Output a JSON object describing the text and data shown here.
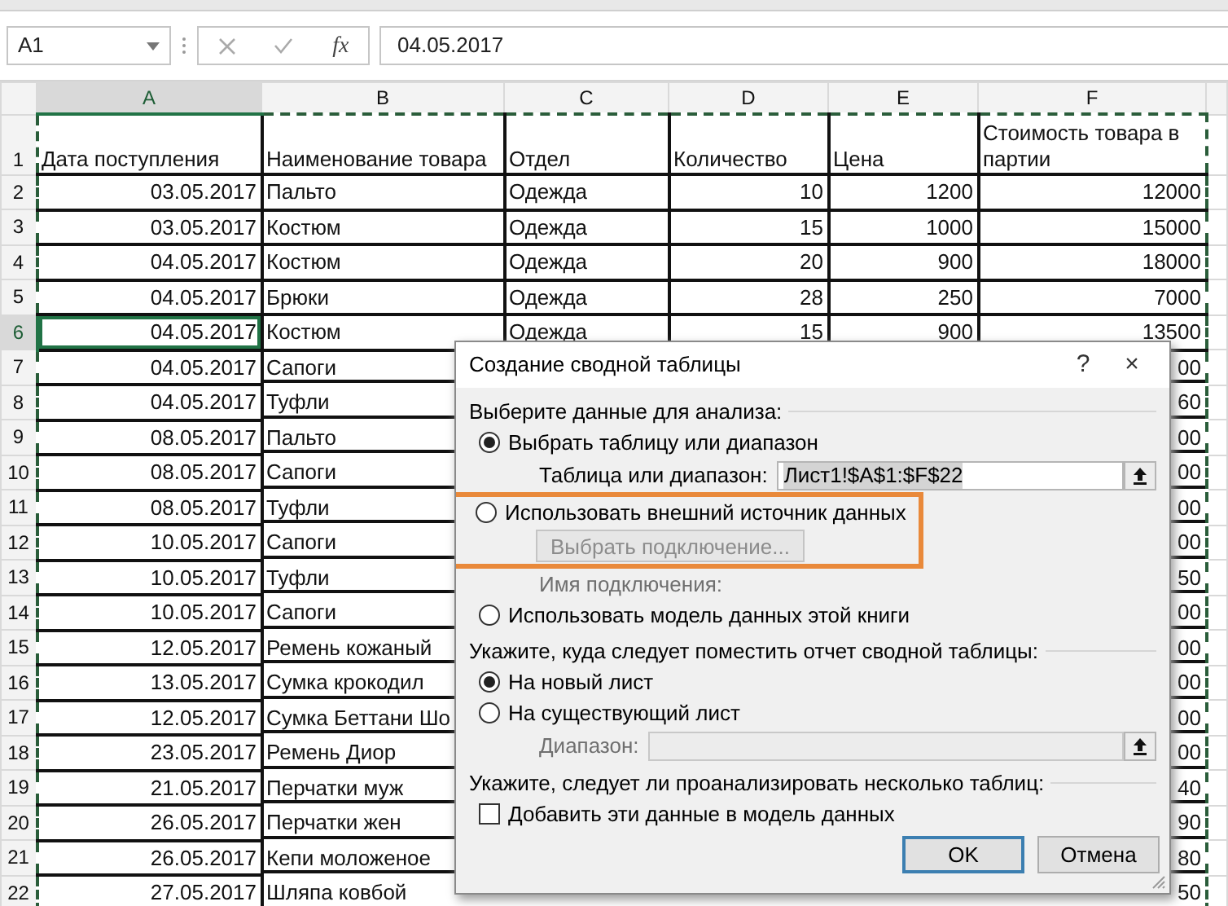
{
  "name_box": {
    "value": "A1"
  },
  "formula_bar": {
    "function_label": "fx",
    "value": "04.05.2017"
  },
  "sheet": {
    "columns": [
      {
        "letter": "A",
        "selected": true,
        "kind": "date"
      },
      {
        "letter": "B",
        "selected": false,
        "kind": "text"
      },
      {
        "letter": "C",
        "selected": false,
        "kind": "text"
      },
      {
        "letter": "D",
        "selected": false,
        "kind": "number"
      },
      {
        "letter": "E",
        "selected": false,
        "kind": "number"
      },
      {
        "letter": "F",
        "selected": false,
        "kind": "number"
      }
    ],
    "rows": [
      {
        "number": "1",
        "kind": "header",
        "selected": false,
        "cells": {
          "A": "Дата поступления",
          "B": "Наименование товара",
          "C": "Отдел",
          "D": "Количество",
          "E": "Цена",
          "F": "Стоимость товара в партии"
        }
      },
      {
        "number": "2",
        "kind": "data",
        "selected": false,
        "cells": {
          "A": "03.05.2017",
          "B": "Пальто",
          "C": "Одежда",
          "D": "10",
          "E": "1200",
          "F": "12000"
        }
      },
      {
        "number": "3",
        "kind": "data",
        "selected": false,
        "cells": {
          "A": "03.05.2017",
          "B": "Костюм",
          "C": "Одежда",
          "D": "15",
          "E": "1000",
          "F": "15000"
        }
      },
      {
        "number": "4",
        "kind": "data",
        "selected": false,
        "cells": {
          "A": "04.05.2017",
          "B": "Костюм",
          "C": "Одежда",
          "D": "20",
          "E": "900",
          "F": "18000"
        }
      },
      {
        "number": "5",
        "kind": "data",
        "selected": false,
        "cells": {
          "A": "04.05.2017",
          "B": "Брюки",
          "C": "Одежда",
          "D": "28",
          "E": "250",
          "F": "7000"
        }
      },
      {
        "number": "6",
        "kind": "data",
        "selected": true,
        "cells": {
          "A": "04.05.2017",
          "B": "Костюм",
          "C": "Одежда",
          "D": "15",
          "E": "900",
          "F": "13500"
        }
      },
      {
        "number": "7",
        "kind": "data",
        "selected": false,
        "cells": {
          "A": "04.05.2017",
          "B": "Сапоги",
          "F": "00"
        }
      },
      {
        "number": "8",
        "kind": "data",
        "selected": false,
        "cells": {
          "A": "04.05.2017",
          "B": "Туфли",
          "F": "60"
        }
      },
      {
        "number": "9",
        "kind": "data",
        "selected": false,
        "cells": {
          "A": "08.05.2017",
          "B": "Пальто",
          "F": "00"
        }
      },
      {
        "number": "10",
        "kind": "data",
        "selected": false,
        "cells": {
          "A": "08.05.2017",
          "B": "Сапоги",
          "F": "00"
        }
      },
      {
        "number": "11",
        "kind": "data",
        "selected": false,
        "cells": {
          "A": "08.05.2017",
          "B": "Туфли",
          "F": "00"
        }
      },
      {
        "number": "12",
        "kind": "data",
        "selected": false,
        "cells": {
          "A": "10.05.2017",
          "B": "Сапоги",
          "F": "00"
        }
      },
      {
        "number": "13",
        "kind": "data",
        "selected": false,
        "cells": {
          "A": "10.05.2017",
          "B": "Туфли",
          "F": "50"
        }
      },
      {
        "number": "14",
        "kind": "data",
        "selected": false,
        "cells": {
          "A": "10.05.2017",
          "B": "Сапоги",
          "F": "00"
        }
      },
      {
        "number": "15",
        "kind": "data",
        "selected": false,
        "cells": {
          "A": "12.05.2017",
          "B": "Ремень кожаный",
          "F": "00"
        }
      },
      {
        "number": "16",
        "kind": "data",
        "selected": false,
        "cells": {
          "A": "13.05.2017",
          "B": "Сумка крокодил",
          "F": "00"
        }
      },
      {
        "number": "17",
        "kind": "data",
        "selected": false,
        "cells": {
          "A": "12.05.2017",
          "B": "Сумка Беттани Шо",
          "F": "00"
        }
      },
      {
        "number": "18",
        "kind": "data",
        "selected": false,
        "cells": {
          "A": "23.05.2017",
          "B": "Ремень Диор",
          "F": "00"
        }
      },
      {
        "number": "19",
        "kind": "data",
        "selected": false,
        "cells": {
          "A": "21.05.2017",
          "B": "Перчатки муж",
          "F": "40"
        }
      },
      {
        "number": "20",
        "kind": "data",
        "selected": false,
        "cells": {
          "A": "26.05.2017",
          "B": "Перчатки жен",
          "F": "90"
        }
      },
      {
        "number": "21",
        "kind": "data",
        "selected": false,
        "cells": {
          "A": "26.05.2017",
          "B": "Кепи моложеное",
          "F": "80"
        }
      },
      {
        "number": "22",
        "kind": "data",
        "selected": false,
        "cells": {
          "A": "27.05.2017",
          "B": "Шляпа ковбой",
          "F": "50"
        }
      }
    ]
  },
  "dialog": {
    "title": "Создание сводной таблицы",
    "help": "?",
    "close": "×",
    "sections": [
      {
        "heading": "Выберите данные для анализа:",
        "items": [
          {
            "kind": "radio",
            "label": "Выбрать таблицу или диапазон",
            "selected": true,
            "highlighted": false
          },
          {
            "kind": "field",
            "label": "Таблица или диапазон:",
            "value": "Лист1!$A$1:$F$22",
            "disabled": false,
            "highlighted": false
          },
          {
            "kind": "radio",
            "label": "Использовать внешний источник данных",
            "selected": false,
            "highlighted": true
          },
          {
            "kind": "button",
            "label": "Выбрать подключение...",
            "disabled": true,
            "highlighted": true
          },
          {
            "kind": "caption",
            "label": "Имя подключения:",
            "disabled": true,
            "highlighted": false
          },
          {
            "kind": "radio",
            "label": "Использовать модель данных этой книги",
            "selected": false,
            "highlighted": false
          }
        ]
      },
      {
        "heading": "Укажите, куда следует поместить отчет сводной таблицы:",
        "items": [
          {
            "kind": "radio",
            "label": "На новый лист",
            "selected": true,
            "highlighted": false
          },
          {
            "kind": "radio",
            "label": "На существующий лист",
            "selected": false,
            "highlighted": false
          },
          {
            "kind": "field",
            "label": "Диапазон:",
            "disabled": true,
            "highlighted": false
          }
        ]
      },
      {
        "heading": "Укажите, следует ли проанализировать несколько таблиц:",
        "items": [
          {
            "kind": "checkbox",
            "label": "Добавить эти данные в модель данных",
            "checked": false,
            "highlighted": false
          }
        ]
      }
    ],
    "buttons": [
      {
        "label": "OK",
        "default": true
      },
      {
        "label": "Отмена",
        "default": false
      }
    ]
  }
}
